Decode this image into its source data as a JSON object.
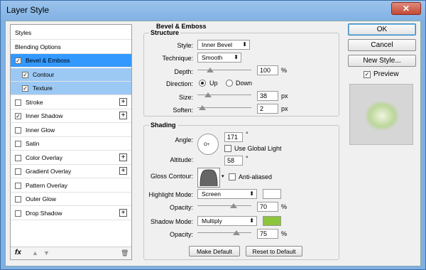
{
  "window": {
    "title": "Layer Style",
    "close_glyph": "✕"
  },
  "left_panel": {
    "items": [
      {
        "label": "Styles",
        "checkbox": false,
        "checked": false,
        "plus": false,
        "state": "normal"
      },
      {
        "label": "Blending Options",
        "checkbox": false,
        "checked": false,
        "plus": false,
        "state": "normal"
      },
      {
        "label": "Bevel & Emboss",
        "checkbox": true,
        "checked": true,
        "plus": false,
        "state": "selected"
      },
      {
        "label": "Contour",
        "checkbox": true,
        "checked": true,
        "plus": false,
        "state": "sub"
      },
      {
        "label": "Texture",
        "checkbox": true,
        "checked": true,
        "plus": false,
        "state": "sub"
      },
      {
        "label": "Stroke",
        "checkbox": true,
        "checked": false,
        "plus": true,
        "state": "normal"
      },
      {
        "label": "Inner Shadow",
        "checkbox": true,
        "checked": true,
        "plus": true,
        "state": "normal"
      },
      {
        "label": "Inner Glow",
        "checkbox": true,
        "checked": false,
        "plus": false,
        "state": "normal"
      },
      {
        "label": "Satin",
        "checkbox": true,
        "checked": false,
        "plus": false,
        "state": "normal"
      },
      {
        "label": "Color Overlay",
        "checkbox": true,
        "checked": false,
        "plus": true,
        "state": "normal"
      },
      {
        "label": "Gradient Overlay",
        "checkbox": true,
        "checked": false,
        "plus": true,
        "state": "normal"
      },
      {
        "label": "Pattern Overlay",
        "checkbox": true,
        "checked": false,
        "plus": false,
        "state": "normal"
      },
      {
        "label": "Outer Glow",
        "checkbox": true,
        "checked": false,
        "plus": false,
        "state": "normal"
      },
      {
        "label": "Drop Shadow",
        "checkbox": true,
        "checked": false,
        "plus": true,
        "state": "normal"
      }
    ],
    "footer": {
      "fx": "fx",
      "up": "▲",
      "down": "▼",
      "trash": "🗑"
    },
    "check_glyph": "✓",
    "plus_glyph": "+"
  },
  "bevel": {
    "title": "Bevel & Emboss",
    "structure": {
      "title": "Structure",
      "style_label": "Style:",
      "style_value": "Inner Bevel",
      "technique_label": "Technique:",
      "technique_value": "Smooth",
      "depth_label": "Depth:",
      "depth_value": "100",
      "depth_unit": "%",
      "depth_level": 0.2,
      "direction_label": "Direction:",
      "direction_up": "Up",
      "direction_down": "Down",
      "direction_selected": "Up",
      "size_label": "Size:",
      "size_value": "38",
      "size_unit": "px",
      "size_level": 0.15,
      "soften_label": "Soften:",
      "soften_value": "2",
      "soften_unit": "px",
      "soften_level": 0.03
    },
    "shading": {
      "title": "Shading",
      "angle_label": "Angle:",
      "angle_value": "171",
      "angle_unit": "°",
      "global_light_label": "Use Global Light",
      "global_light_checked": false,
      "altitude_label": "Altitude:",
      "altitude_value": "58",
      "altitude_unit": "°",
      "gloss_label": "Gloss Contour:",
      "anti_aliased_label": "Anti-aliased",
      "anti_aliased_checked": false,
      "highlight_mode_label": "Highlight Mode:",
      "highlight_mode_value": "Screen",
      "highlight_color": "#ffffff",
      "highlight_opacity_label": "Opacity:",
      "highlight_opacity_value": "70",
      "highlight_opacity_unit": "%",
      "highlight_opacity_level": 0.7,
      "shadow_mode_label": "Shadow Mode:",
      "shadow_mode_value": "Multiply",
      "shadow_color": "#8cc43c",
      "shadow_opacity_label": "Opacity:",
      "shadow_opacity_value": "75",
      "shadow_opacity_unit": "%",
      "shadow_opacity_level": 0.75
    },
    "make_default": "Make Default",
    "reset_default": "Reset to Default"
  },
  "right": {
    "ok": "OK",
    "cancel": "Cancel",
    "new_style": "New Style...",
    "preview_label": "Preview",
    "preview_checked": true
  },
  "icons": {
    "dropdown": "dropdown-arrow-icon",
    "close": "close-icon",
    "add": "plus-icon",
    "trash": "trash-icon",
    "fx": "fx-icon"
  },
  "colors": {
    "selected_row": "#3399ff",
    "sub_row": "#9cc9f4",
    "title_bar": "#8ab8e8",
    "shadow_swatch": "#8cc43c"
  }
}
